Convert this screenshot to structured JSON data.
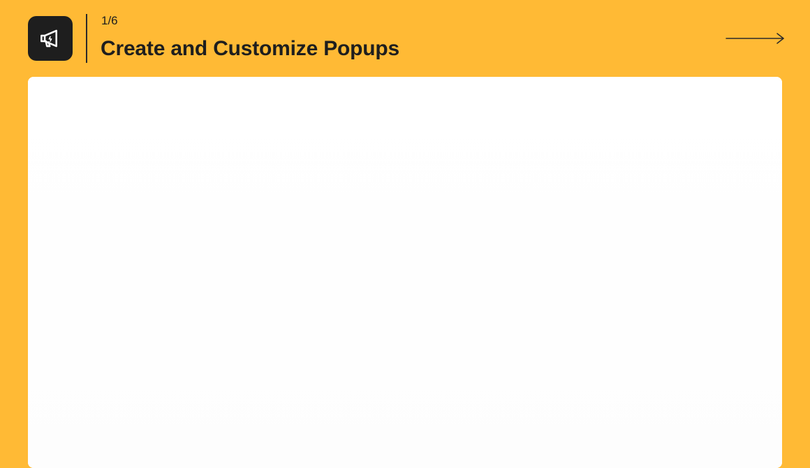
{
  "header": {
    "step_counter": "1/6",
    "title": "Create and Customize Popups",
    "icon": "megaphone-icon",
    "next_icon": "arrow-right-icon"
  },
  "colors": {
    "background": "#FFBA35",
    "icon_tile": "#1E1E1E",
    "text": "#1E1E1E",
    "card": "#FFFFFF"
  }
}
